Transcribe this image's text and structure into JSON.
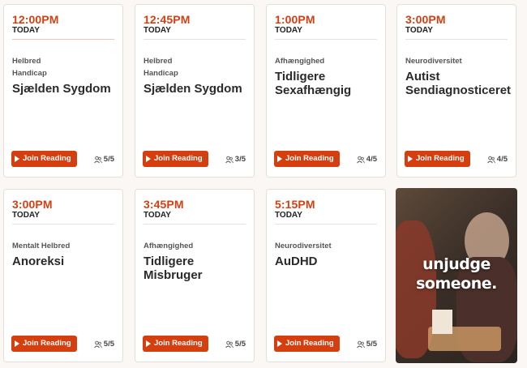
{
  "cards": [
    {
      "time": "12:00PM",
      "day": "TODAY",
      "categories": [
        "Helbred",
        "Handicap"
      ],
      "title": "Sjælden Sygdom",
      "cta": "Join Reading",
      "seats": "5/5"
    },
    {
      "time": "12:45PM",
      "day": "TODAY",
      "categories": [
        "Helbred",
        "Handicap"
      ],
      "title": "Sjælden Sygdom",
      "cta": "Join Reading",
      "seats": "3/5"
    },
    {
      "time": "1:00PM",
      "day": "TODAY",
      "categories": [
        "Afhængighed"
      ],
      "title": "Tidligere Sexafhængig",
      "cta": "Join Reading",
      "seats": "4/5"
    },
    {
      "time": "3:00PM",
      "day": "TODAY",
      "categories": [
        "Neurodiversitet"
      ],
      "title": "Autist Sendiagnosticeret",
      "cta": "Join Reading",
      "seats": "4/5"
    },
    {
      "time": "3:00PM",
      "day": "TODAY",
      "categories": [
        "Mentalt Helbred"
      ],
      "title": "Anoreksi",
      "cta": "Join Reading",
      "seats": "5/5"
    },
    {
      "time": "3:45PM",
      "day": "TODAY",
      "categories": [
        "Afhængighed"
      ],
      "title": "Tidligere Misbruger",
      "cta": "Join Reading",
      "seats": "5/5"
    },
    {
      "time": "5:15PM",
      "day": "TODAY",
      "categories": [
        "Neurodiversitet"
      ],
      "title": "AuDHD",
      "cta": "Join Reading",
      "seats": "5/5"
    }
  ],
  "promo": {
    "line1": "unjudge",
    "line2": "someone."
  },
  "colors": {
    "accent": "#d53e0f",
    "time": "#d23f12"
  },
  "icons": {
    "play": "play-icon",
    "seats": "people-icon"
  }
}
